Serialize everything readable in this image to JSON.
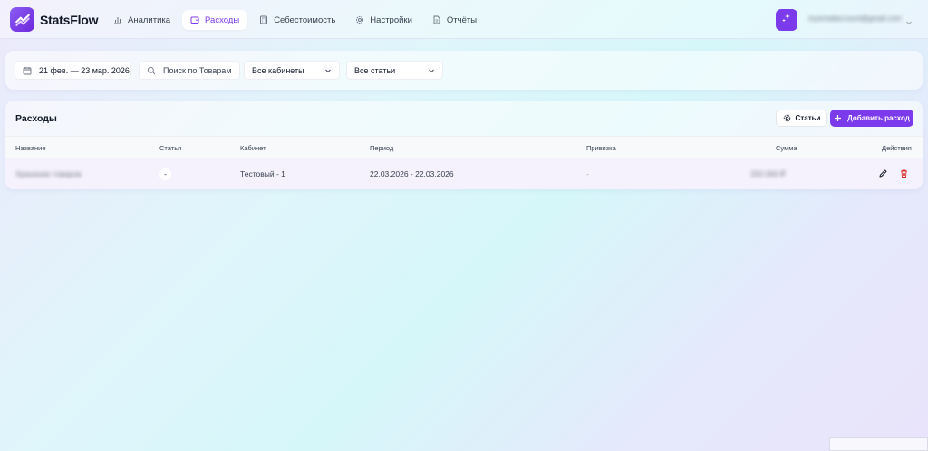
{
  "app": {
    "name": "StatsFlow",
    "brand_color": "#7c3aed"
  },
  "nav": {
    "items": [
      {
        "label": "Аналитика",
        "icon": "bar-chart-icon",
        "active": false
      },
      {
        "label": "Расходы",
        "icon": "wallet-icon",
        "active": true
      },
      {
        "label": "Себестоимость",
        "icon": "calculator-icon",
        "active": false
      },
      {
        "label": "Настройки",
        "icon": "gear-icon",
        "active": false
      },
      {
        "label": "Отчёты",
        "icon": "document-icon",
        "active": false
      }
    ]
  },
  "user": {
    "email": "myemailaccount@gmail.com"
  },
  "filters": {
    "date_range": "21 фев. — 23 мар. 2026",
    "search_placeholder": "Поиск по Товарам",
    "cabinet": "Все кабинеты",
    "articles": "Все статьи"
  },
  "expenses": {
    "title": "Расходы",
    "articles_button": "Статьи",
    "add_button": "Добавить расход",
    "columns": [
      "Название",
      "Статья",
      "Кабинет",
      "Период",
      "Привязка",
      "Сумма",
      "Действия"
    ],
    "rows": [
      {
        "name": "Хранение товаров",
        "article": "-",
        "cabinet": "Тестовый - 1",
        "period": "22.03.2026 - 22.03.2026",
        "binding": "-",
        "amount": "250 000 ₽"
      }
    ]
  }
}
